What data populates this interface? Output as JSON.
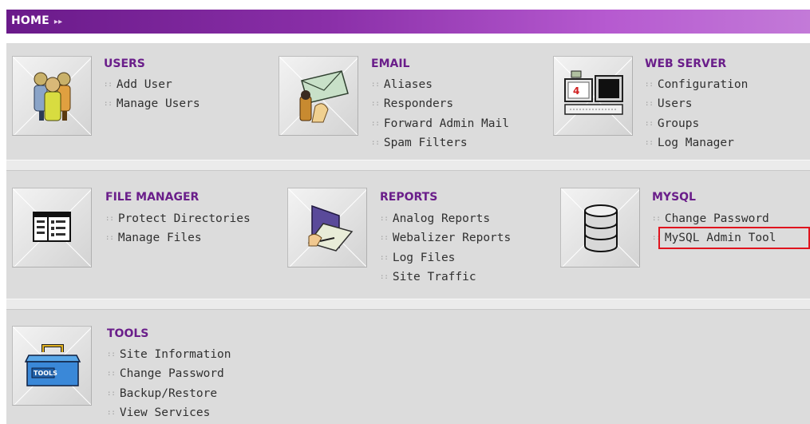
{
  "header": {
    "title": "HOME",
    "arrows": "▸▸"
  },
  "bullet": "::",
  "sections": {
    "users": {
      "title": "USERS",
      "links": [
        "Add User",
        "Manage Users"
      ]
    },
    "email": {
      "title": "EMAIL",
      "links": [
        "Aliases",
        "Responders",
        "Forward Admin Mail",
        "Spam Filters"
      ]
    },
    "web_server": {
      "title": "WEB SERVER",
      "links": [
        "Configuration",
        "Users",
        "Groups",
        "Log Manager"
      ]
    },
    "file_manager": {
      "title": "FILE MANAGER",
      "links": [
        "Protect Directories",
        "Manage Files"
      ]
    },
    "reports": {
      "title": "REPORTS",
      "links": [
        "Analog Reports",
        "Webalizer Reports",
        "Log Files",
        "Site Traffic"
      ]
    },
    "mysql": {
      "title": "MYSQL",
      "links": [
        "Change Password",
        "MySQL Admin Tool"
      ]
    },
    "tools": {
      "title": "TOOLS",
      "links": [
        "Site Information",
        "Change Password",
        "Backup/Restore",
        "View Services"
      ]
    }
  },
  "icons": {
    "users": "users-icon",
    "email": "email-icon",
    "web_server": "web-server-icon",
    "file_manager": "file-manager-icon",
    "reports": "reports-icon",
    "mysql": "database-icon",
    "tools": "toolbox-icon"
  },
  "colors": {
    "header": "#7a2696",
    "title": "#6a1e8a",
    "highlight": "#e0141e"
  }
}
